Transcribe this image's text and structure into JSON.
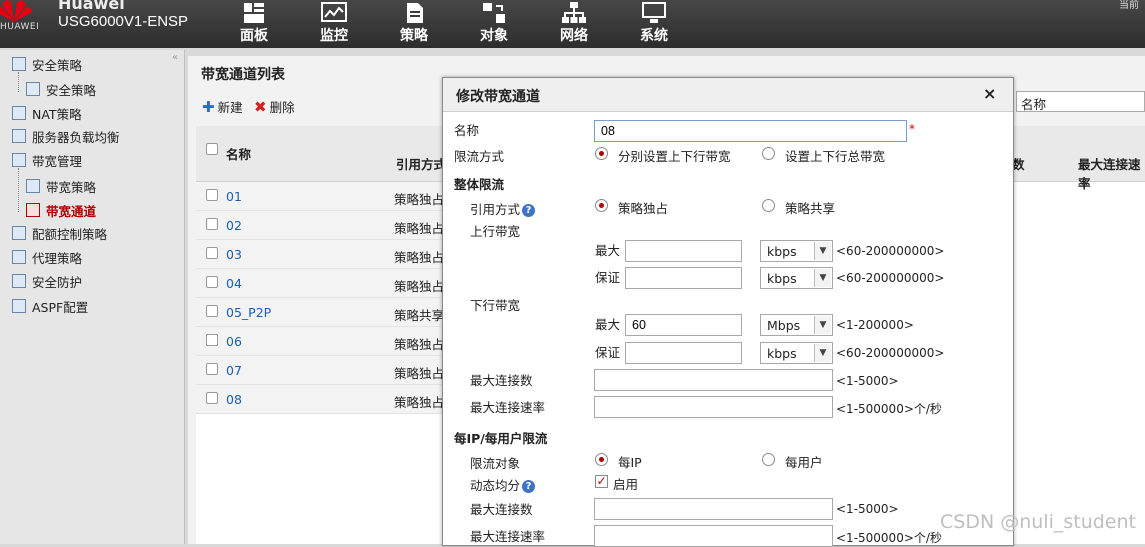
{
  "header": {
    "logo_text": "HUAWEI",
    "brand": "Huawei",
    "device": "USG6000V1-ENSP",
    "nav": [
      {
        "label": "面板",
        "icon": "dashboard-icon"
      },
      {
        "label": "监控",
        "icon": "monitor-icon"
      },
      {
        "label": "策略",
        "icon": "policy-icon"
      },
      {
        "label": "对象",
        "icon": "object-icon"
      },
      {
        "label": "网络",
        "icon": "network-icon"
      },
      {
        "label": "系统",
        "icon": "system-icon"
      }
    ],
    "top_right": "当前"
  },
  "sidebar": {
    "items": [
      {
        "label": "安全策略",
        "icon": "security-policy-icon"
      },
      {
        "label": "安全策略",
        "icon": "security-policy-sub-icon"
      },
      {
        "label": "NAT策略",
        "icon": "nat-icon"
      },
      {
        "label": "服务器负载均衡",
        "icon": "slb-icon"
      },
      {
        "label": "带宽管理",
        "icon": "bandwidth-icon"
      },
      {
        "label": "带宽策略",
        "icon": "bandwidth-policy-icon"
      },
      {
        "label": "带宽通道",
        "icon": "bandwidth-channel-icon"
      },
      {
        "label": "配额控制策略",
        "icon": "quota-icon"
      },
      {
        "label": "代理策略",
        "icon": "proxy-icon"
      },
      {
        "label": "安全防护",
        "icon": "shield-icon"
      },
      {
        "label": "ASPF配置",
        "icon": "aspf-icon"
      }
    ]
  },
  "list": {
    "title": "带宽通道列表",
    "new_label": "新建",
    "delete_label": "删除",
    "columns": {
      "name": "名称",
      "ref": "引用方式",
      "count_tail": "数",
      "max_rate": "最大连接速率"
    },
    "search_field": "名称",
    "rows": [
      {
        "name": "01",
        "ref": "策略独占"
      },
      {
        "name": "02",
        "ref": "策略独占"
      },
      {
        "name": "03",
        "ref": "策略独占"
      },
      {
        "name": "04",
        "ref": "策略独占"
      },
      {
        "name": "05_P2P",
        "ref": "策略共享"
      },
      {
        "name": "06",
        "ref": "策略独占"
      },
      {
        "name": "07",
        "ref": "策略独占"
      },
      {
        "name": "08",
        "ref": "策略独占"
      }
    ]
  },
  "dialog": {
    "title": "修改带宽通道",
    "close": "×",
    "name_label": "名称",
    "name_value": "08",
    "required_mark": "*",
    "limit_mode_label": "限流方式",
    "limit_mode_opt1": "分别设置上下行带宽",
    "limit_mode_opt2": "设置上下行总带宽",
    "overall_section": "整体限流",
    "ref_label": "引用方式",
    "ref_opt1": "策略独占",
    "ref_opt2": "策略共享",
    "up_label": "上行带宽",
    "down_label": "下行带宽",
    "max_label": "最大",
    "guarantee_label": "保证",
    "up_max_value": "",
    "up_max_unit": "kbps",
    "up_max_hint": "<60-200000000>",
    "up_gua_value": "",
    "up_gua_unit": "kbps",
    "up_gua_hint": "<60-200000000>",
    "down_max_value": "60",
    "down_max_unit": "Mbps",
    "down_max_hint": "<1-200000>",
    "down_gua_value": "",
    "down_gua_unit": "kbps",
    "down_gua_hint": "<60-200000000>",
    "max_conn_label": "最大连接数",
    "max_conn_hint": "<1-5000>",
    "max_rate_label": "最大连接速率",
    "max_rate_hint": "<1-500000>个/秒",
    "perip_section": "每IP/每用户限流",
    "target_label": "限流对象",
    "target_opt1": "每IP",
    "target_opt2": "每用户",
    "dyn_label": "动态均分",
    "dyn_enable": "启用",
    "per_max_conn_label": "最大连接数",
    "per_max_conn_hint": "<1-5000>",
    "per_max_rate_label": "最大连接速率",
    "per_max_rate_hint": "<1-500000>个/秒"
  },
  "watermark": "CSDN @nuli_student",
  "colors": {
    "accent_red": "#b00000",
    "link_blue": "#1a5fb4",
    "topbar": "#3a3a3a"
  }
}
